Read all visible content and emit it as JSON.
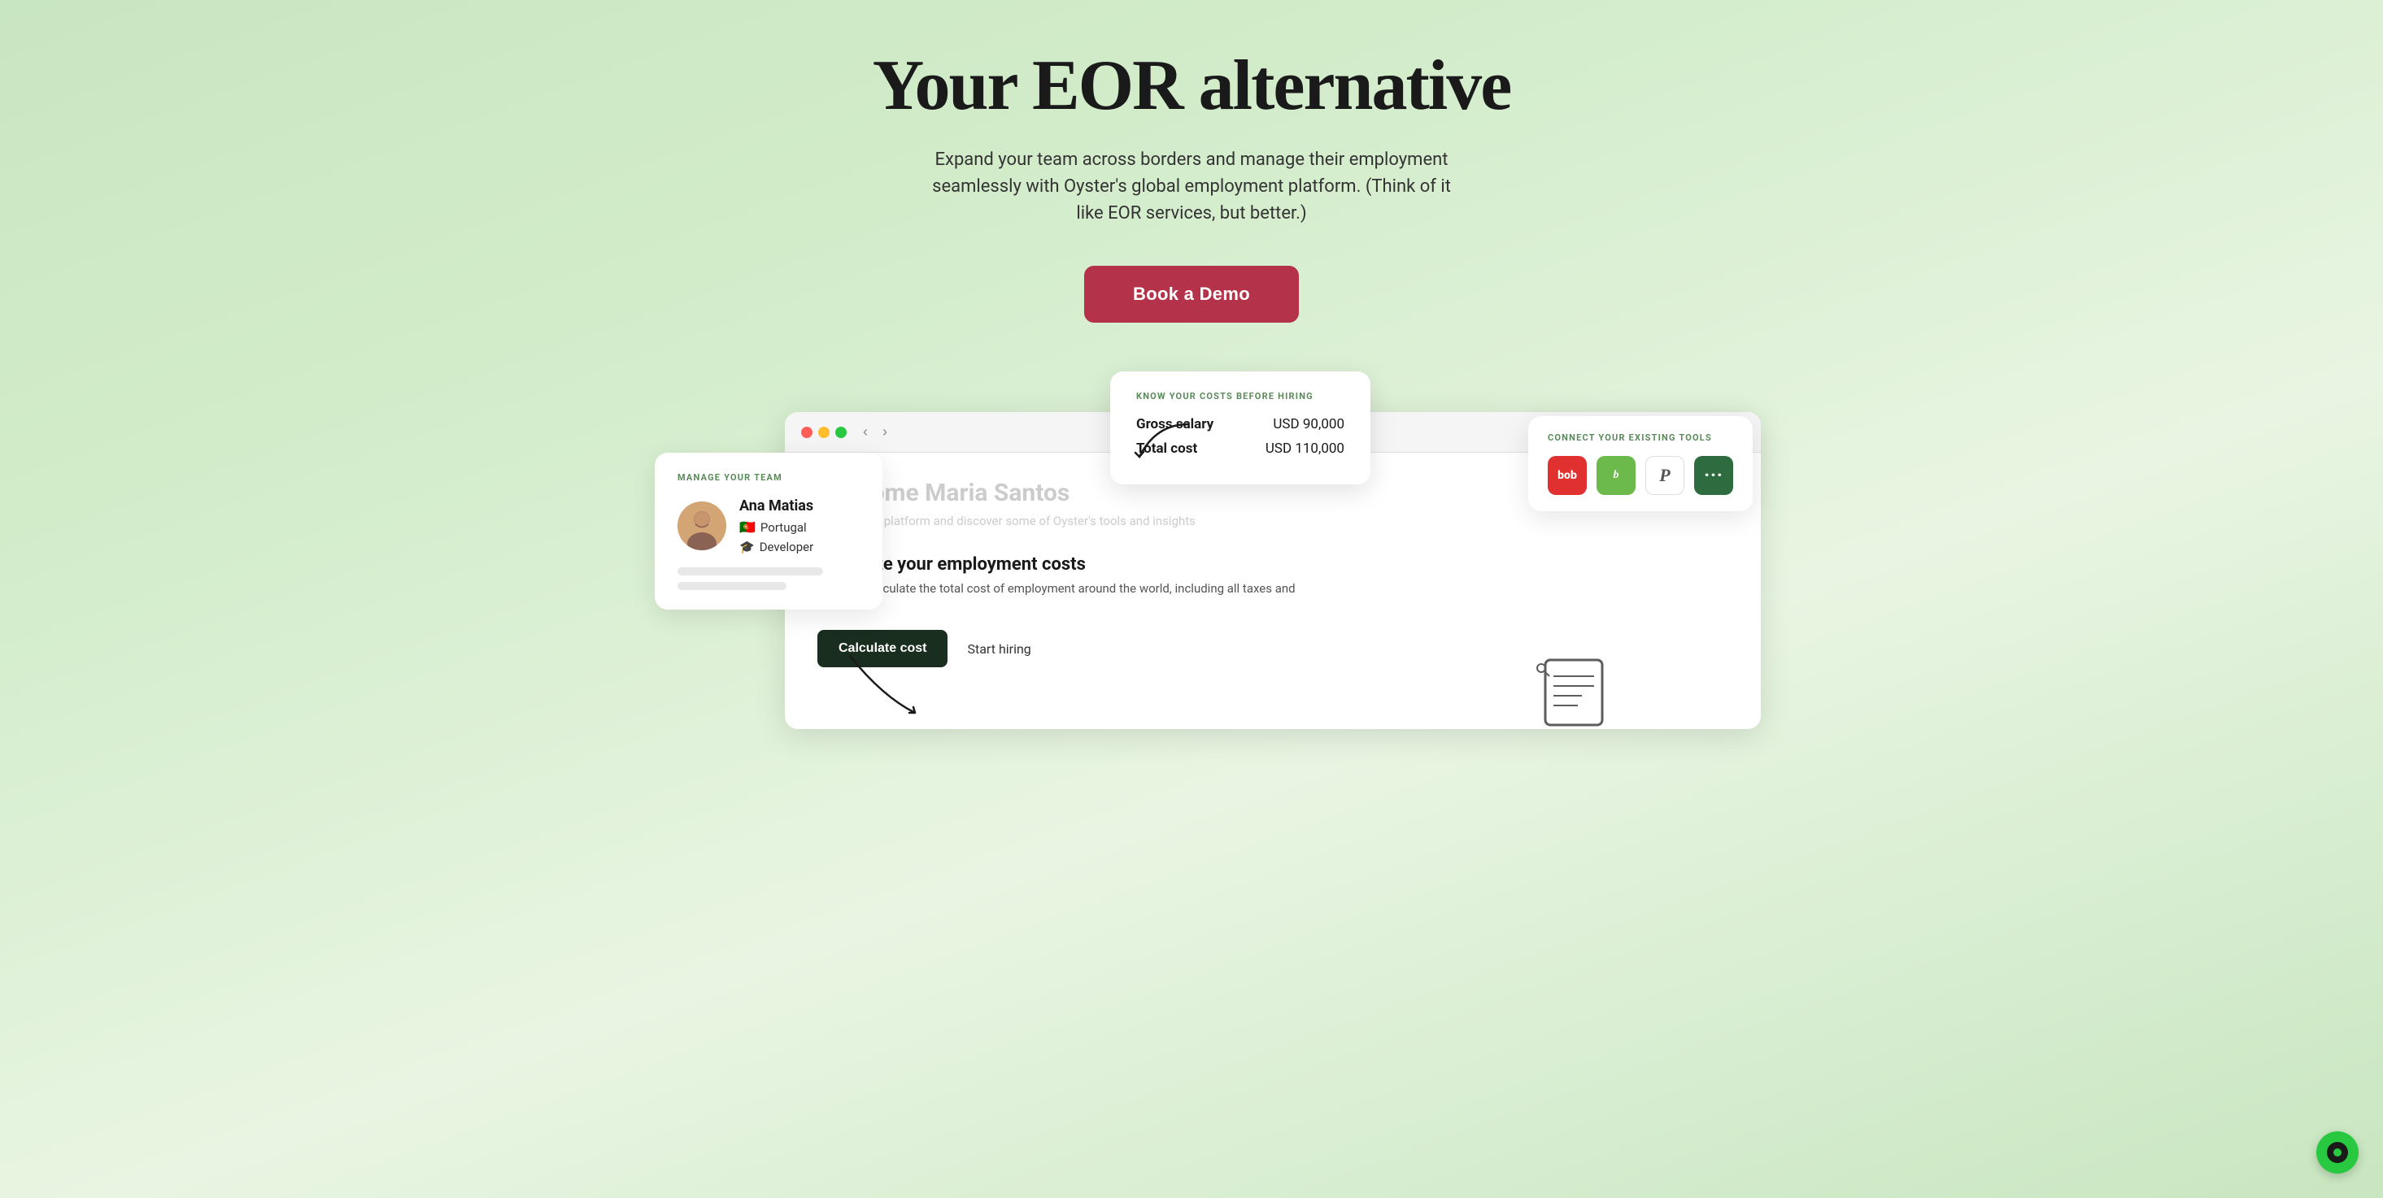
{
  "hero": {
    "title": "Your EOR alternative",
    "subtitle": "Expand your team across borders and manage their employment seamlessly with Oyster's global employment platform. (Think of it like EOR services, but better.)",
    "cta_label": "Book a Demo"
  },
  "cost_tooltip": {
    "title": "KNOW YOUR COSTS BEFORE HIRING",
    "gross_salary_label": "Gross salary",
    "gross_salary_value": "USD 90,000",
    "total_cost_label": "Total cost",
    "total_cost_value": "USD 110,000"
  },
  "manage_team_card": {
    "title": "MANAGE YOUR TEAM",
    "person_name": "Ana Matias",
    "person_country": "Portugal",
    "person_role": "Developer"
  },
  "browser": {
    "welcome_heading": "Welcome Maria Santos",
    "welcome_sub": "Preview our platform and discover some of Oyster's tools and insights",
    "calc_title": "Calculate your employment costs",
    "calc_desc": "Instantly calculate the total cost of employment around the world, including all taxes and deductions",
    "calc_button_label": "Calculate cost",
    "hire_link_label": "Start hiring"
  },
  "connect_tools": {
    "title": "CONNECT YOUR EXISTING TOOLS",
    "tools": [
      {
        "name": "bob",
        "label": "bob",
        "color": "#e03030"
      },
      {
        "name": "bamboo",
        "label": "b",
        "color": "#6dba4c"
      },
      {
        "name": "personio",
        "label": "P",
        "color": "#ffffff"
      },
      {
        "name": "more",
        "label": "...",
        "color": "#2e6b3e"
      }
    ]
  },
  "chat": {
    "icon_label": "chat-widget"
  },
  "icons": {
    "nav_back": "‹",
    "nav_forward": "›",
    "reload": "↻",
    "share": "⎙",
    "add_tab": "+"
  }
}
